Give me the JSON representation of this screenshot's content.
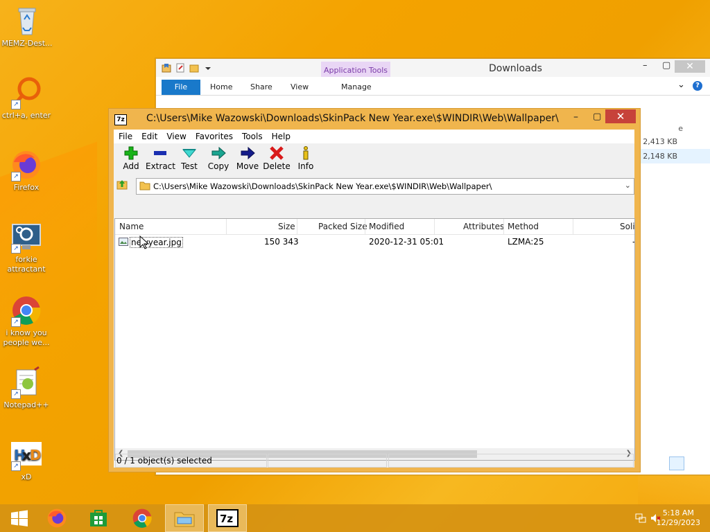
{
  "desktop": {
    "icons": [
      {
        "label": "MEMZ-Dest...",
        "icon": "recycle-bin-icon"
      },
      {
        "label": "ctrl+a, enter",
        "icon": "search-circle-icon"
      },
      {
        "label": "Firefox",
        "icon": "firefox-icon"
      },
      {
        "label": "forkie attractant",
        "icon": "computer-settings-icon"
      },
      {
        "label": "i know you people we...",
        "icon": "chrome-icon"
      },
      {
        "label": "Notepad++",
        "icon": "notepadpp-icon"
      },
      {
        "label": "xD",
        "icon": "hxd-icon"
      }
    ]
  },
  "explorer": {
    "title": "Downloads",
    "context_tab": "Application Tools",
    "tabs": [
      "File",
      "Home",
      "Share",
      "View",
      "Manage"
    ],
    "column_fragment": "e",
    "sizes": [
      "2,413 KB",
      "2,148 KB"
    ],
    "help": "?"
  },
  "sevenzip": {
    "app_icon_text": "7z",
    "title": "C:\\Users\\Mike Wazowski\\Downloads\\SkinPack New Year.exe\\$WINDIR\\Web\\Wallpaper\\",
    "menu": [
      "File",
      "Edit",
      "View",
      "Favorites",
      "Tools",
      "Help"
    ],
    "toolbar": [
      "Add",
      "Extract",
      "Test",
      "Copy",
      "Move",
      "Delete",
      "Info"
    ],
    "address": "C:\\Users\\Mike Wazowski\\Downloads\\SkinPack New Year.exe\\$WINDIR\\Web\\Wallpaper\\",
    "columns": {
      "name": "Name",
      "size": "Size",
      "packed": "Packed Size",
      "modified": "Modified",
      "attributes": "Attributes",
      "method": "Method",
      "solid": "Soli"
    },
    "rows": [
      {
        "name": "newyear.jpg",
        "size": "150 343",
        "packed": "",
        "modified": "2020-12-31 05:01",
        "attributes": "",
        "method": "LZMA:25",
        "solid": "-"
      }
    ],
    "status": "0 / 1 object(s) selected"
  },
  "taskbar": {
    "apps": [
      "start-icon",
      "firefox-icon",
      "store-icon",
      "chrome-icon",
      "file-explorer-icon",
      "sevenzip-icon"
    ],
    "time": "5:18 AM",
    "date": "12/29/2023"
  },
  "colors": {
    "accent": "#1979ca",
    "window_border": "#f0b54d",
    "close": "#c7423a",
    "taskbar": "#d69212"
  }
}
